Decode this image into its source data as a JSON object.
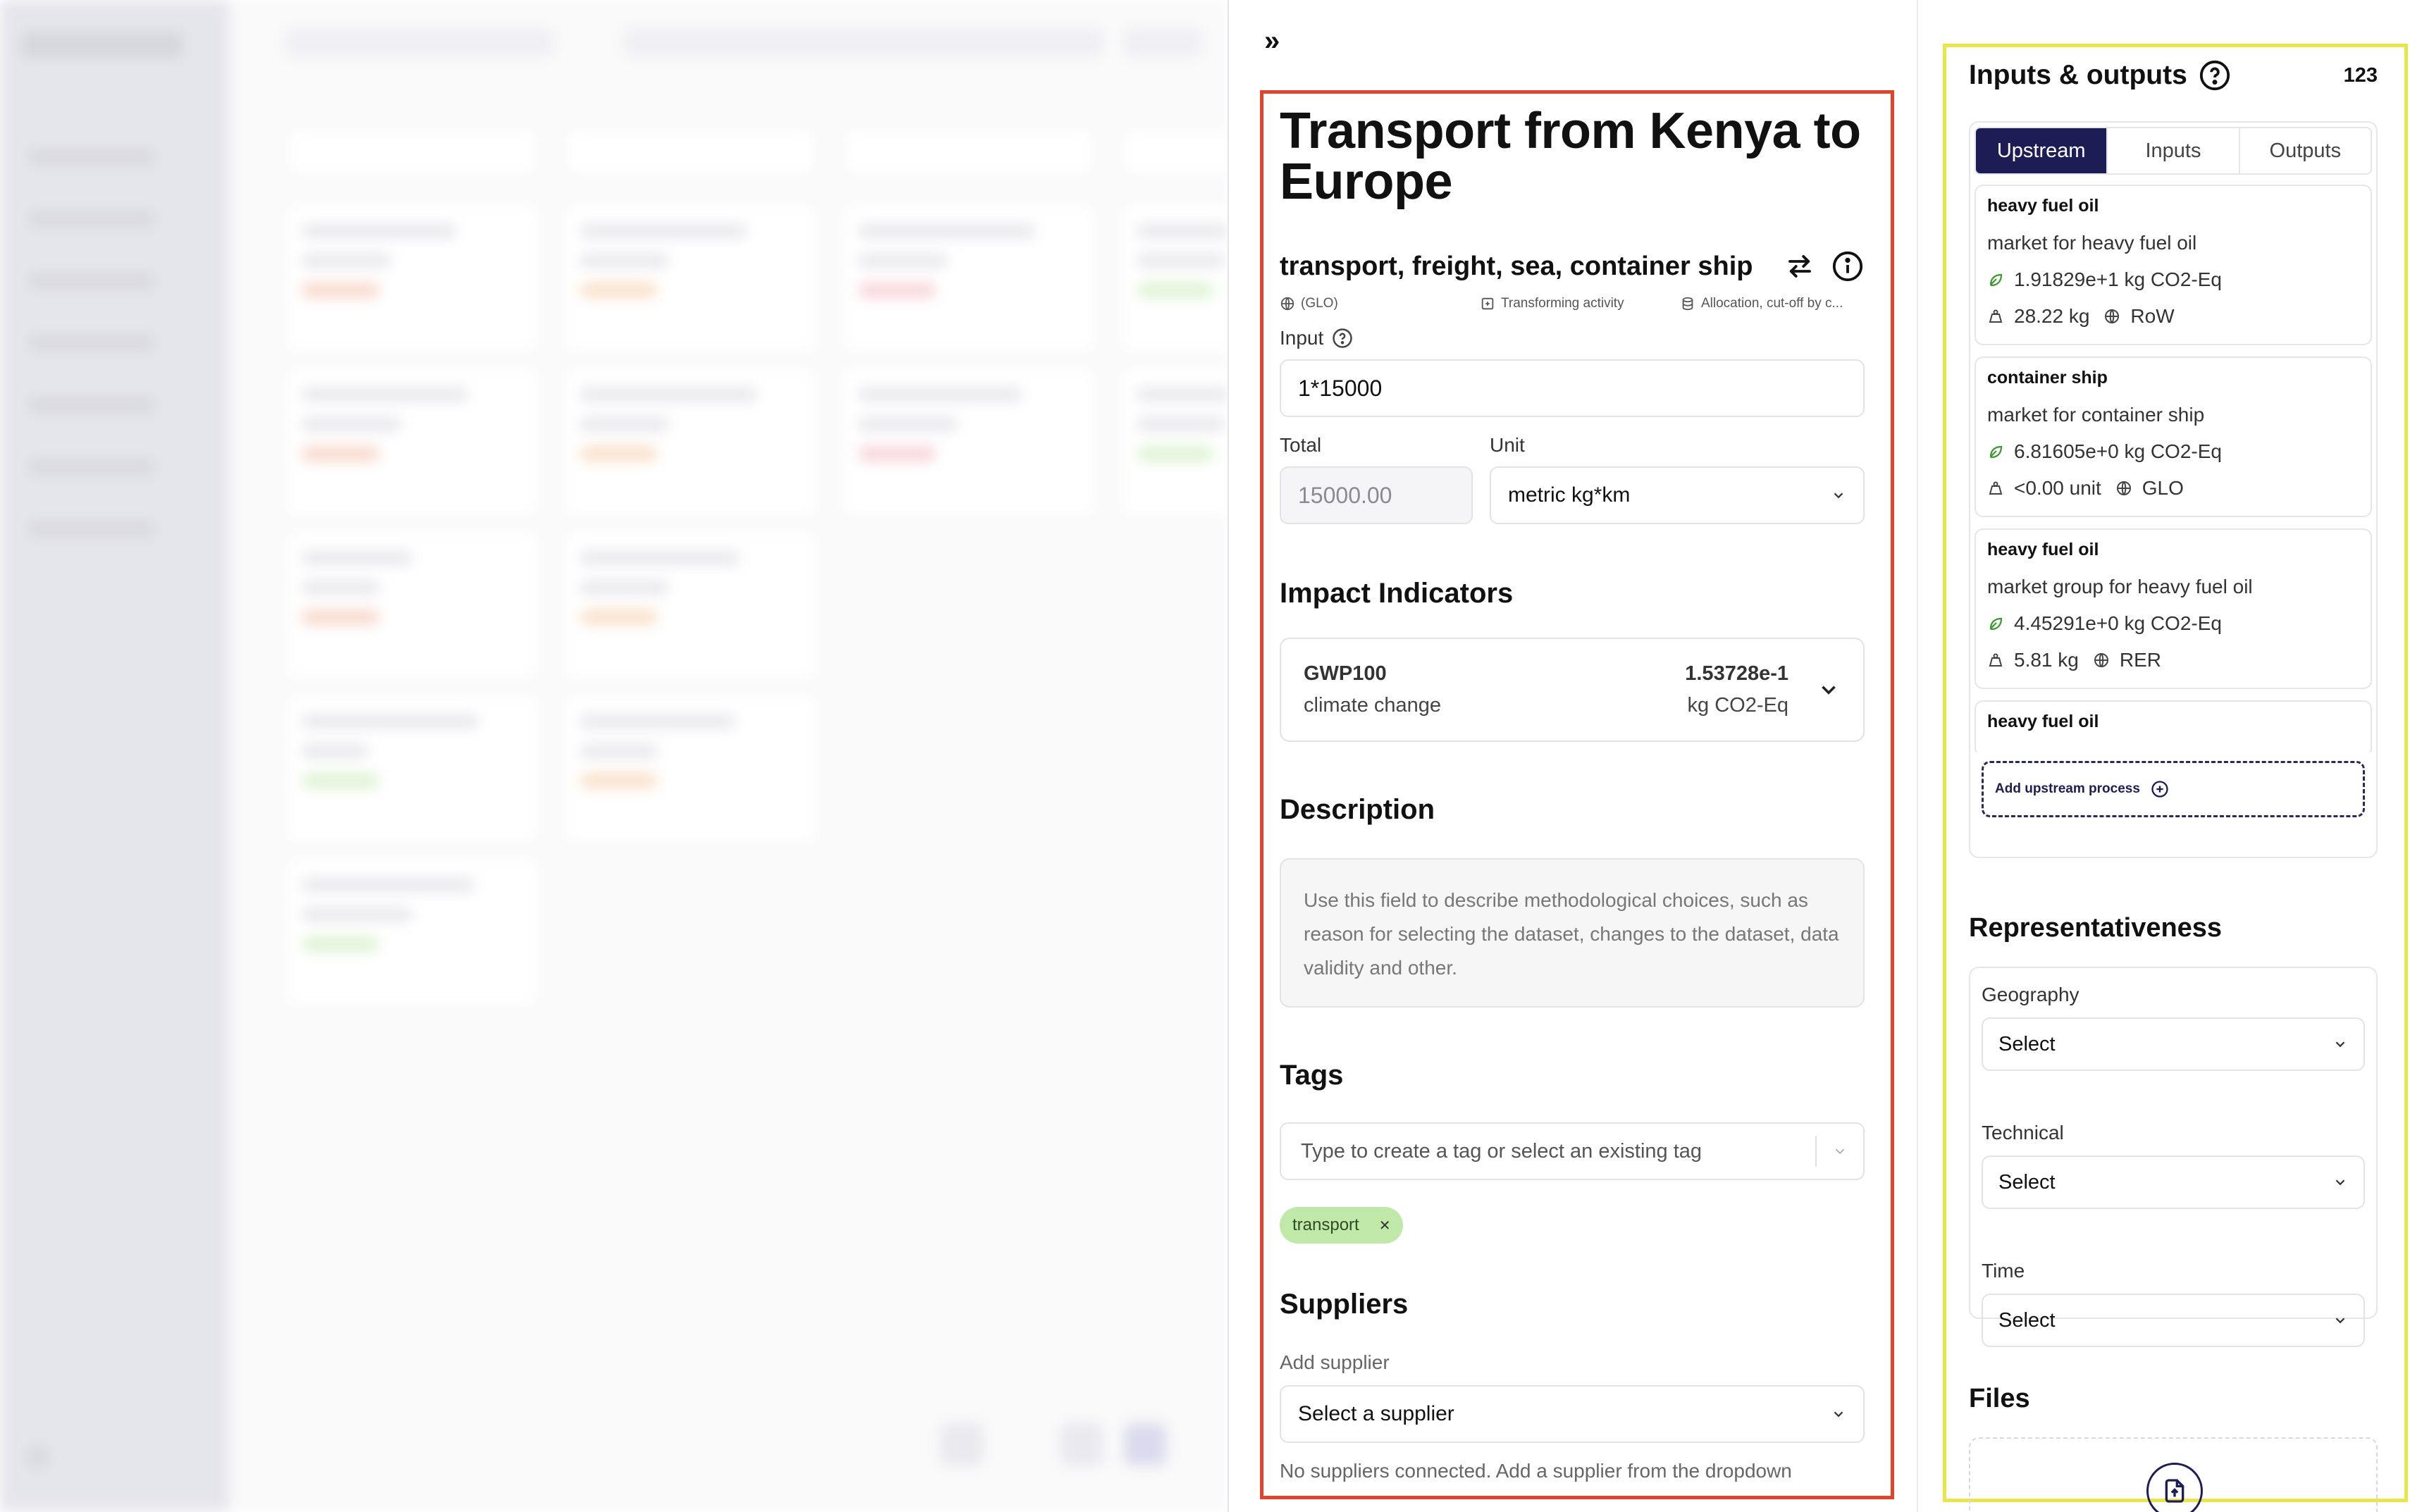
{
  "detail": {
    "title": "Transport from Kenya to Europe",
    "activity_name": "transport, freight, sea, container ship",
    "geography": "(GLO)",
    "activity_type": "Transforming activity",
    "system_model": "Allocation, cut-off by c...",
    "input_label": "Input",
    "input_value": "1*15000",
    "total_label": "Total",
    "total_value": "15000.00",
    "unit_label": "Unit",
    "unit_value": "metric kg*km",
    "impact_section": "Impact Indicators",
    "impact": {
      "method": "GWP100",
      "category": "climate change",
      "value": "1.53728e-1",
      "unit": "kg CO2-Eq"
    },
    "description_section": "Description",
    "description_placeholder": "Use this field to describe methodological choices, such as reason for selecting the dataset, changes to the dataset, data validity and other.",
    "tags_section": "Tags",
    "tags_placeholder": "Type to create a tag or select an existing tag",
    "tags": [
      "transport"
    ],
    "suppliers_section": "Suppliers",
    "add_supplier_label": "Add supplier",
    "supplier_select": "Select a supplier",
    "no_suppliers_text": "No suppliers connected. Add a supplier from the dropdown"
  },
  "io": {
    "title": "Inputs & outputs",
    "count": "123",
    "tabs": [
      "Upstream",
      "Inputs",
      "Outputs"
    ],
    "active_tab": "Upstream",
    "upstream": [
      {
        "name": "heavy fuel oil",
        "market": "market for heavy fuel oil",
        "impact": "1.91829e+1 kg CO2-Eq",
        "amount": "28.22 kg",
        "geo": "RoW"
      },
      {
        "name": "container ship",
        "market": "market for container ship",
        "impact": "6.81605e+0 kg CO2-Eq",
        "amount": "<0.00 unit",
        "geo": "GLO"
      },
      {
        "name": "heavy fuel oil",
        "market": "market group for heavy fuel oil",
        "impact": "4.45291e+0 kg CO2-Eq",
        "amount": "5.81 kg",
        "geo": "RER"
      },
      {
        "name": "heavy fuel oil",
        "market": "",
        "impact": "",
        "amount": "",
        "geo": ""
      }
    ],
    "add_upstream": "Add upstream process",
    "representativeness_title": "Representativeness",
    "representativeness": [
      {
        "label": "Geography",
        "value": "Select"
      },
      {
        "label": "Technical",
        "value": "Select"
      },
      {
        "label": "Time",
        "value": "Select"
      }
    ],
    "files_title": "Files"
  },
  "colors": {
    "accent": "#1c1d54",
    "detail_outline": "#e0442a",
    "io_outline": "#e9e64a",
    "tag_chip": "#bfe8a9"
  }
}
